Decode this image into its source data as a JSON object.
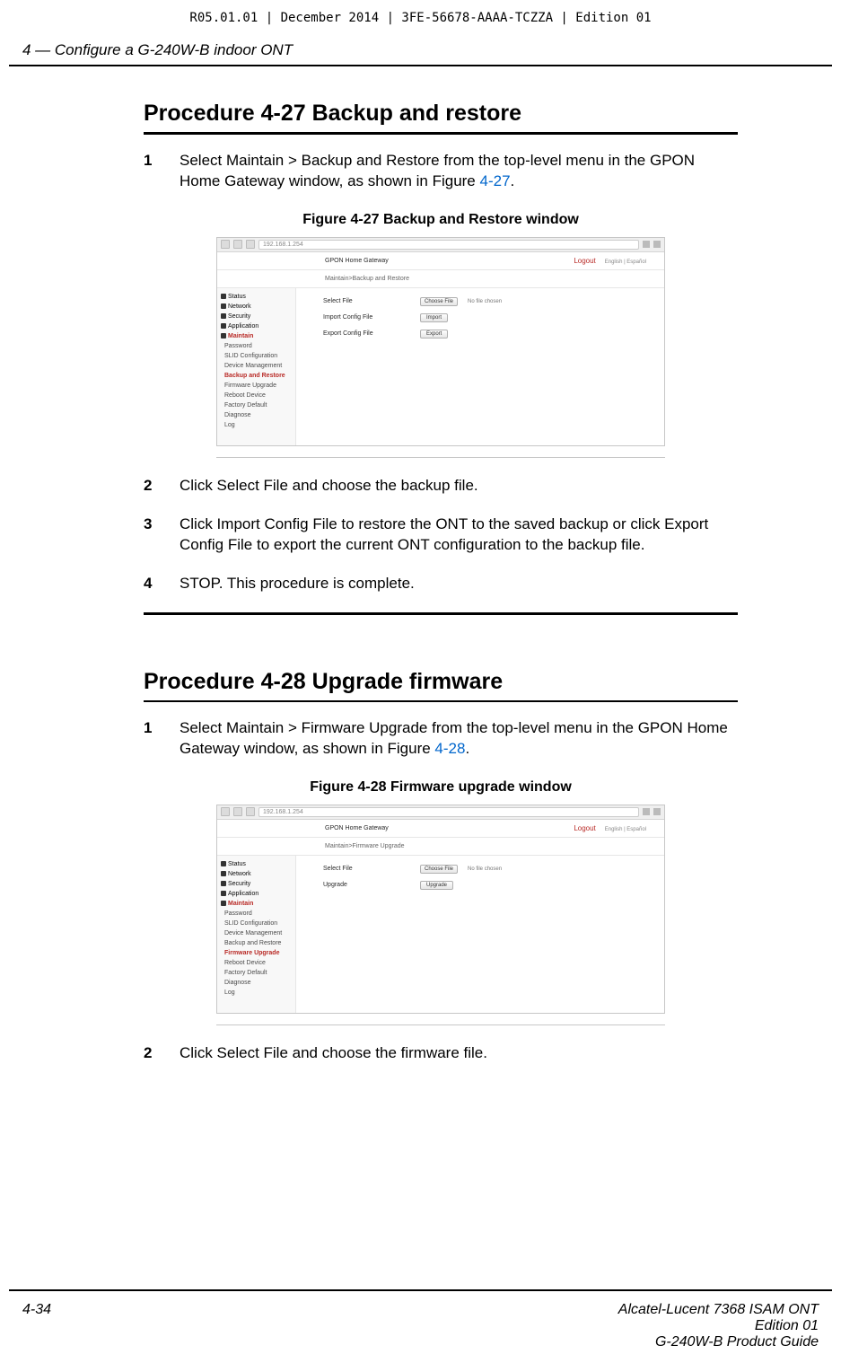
{
  "doc_header": "R05.01.01 | December 2014 | 3FE-56678-AAAA-TCZZA | Edition 01",
  "chapter_heading": "4 —  Configure a G-240W-B indoor ONT",
  "proc_427": {
    "title": "Procedure 4-27  Backup and restore",
    "steps": [
      {
        "n": "1",
        "pre": "Select Maintain > Backup and Restore from the top-level menu in the GPON Home Gateway window, as shown in Figure ",
        "ref": "4-27",
        "post": "."
      },
      {
        "n": "2",
        "text": "Click Select File and choose the backup file."
      },
      {
        "n": "3",
        "text": "Click Import Config File to restore the ONT to the saved backup or click Export Config File to export the current ONT configuration to the backup file."
      },
      {
        "n": "4",
        "text": "STOP. This procedure is complete."
      }
    ]
  },
  "fig_427": {
    "caption": "Figure 4-27  Backup and Restore window",
    "url": "192.168.1.254",
    "app_title": "GPON Home Gateway",
    "logout": "Logout",
    "lang": "English | Español",
    "breadcrumb": "Maintain>Backup and Restore",
    "side_main": [
      "Status",
      "Network",
      "Security",
      "Application"
    ],
    "side_active": "Maintain",
    "side_subs": [
      "Password",
      "SLID Configuration",
      "Device Management",
      "Backup and Restore",
      "Firmware Upgrade",
      "Reboot Device",
      "Factory Default",
      "Diagnose",
      "Log"
    ],
    "side_selected": "Backup and Restore",
    "rows": [
      {
        "label": "Select File",
        "btn": "Choose File",
        "trailing": "No file chosen"
      },
      {
        "label": "Import Config File",
        "btn": "Import"
      },
      {
        "label": "Export Config File",
        "btn": "Export"
      }
    ]
  },
  "proc_428": {
    "title": "Procedure 4-28  Upgrade firmware",
    "steps": [
      {
        "n": "1",
        "pre": "Select Maintain > Firmware Upgrade from the top-level menu in the GPON Home Gateway window, as shown in Figure ",
        "ref": "4-28",
        "post": "."
      },
      {
        "n": "2",
        "text": "Click Select File and choose the firmware file."
      }
    ]
  },
  "fig_428": {
    "caption": "Figure 4-28  Firmware upgrade window",
    "url": "192.168.1.254",
    "app_title": "GPON Home Gateway",
    "logout": "Logout",
    "lang": "English | Español",
    "breadcrumb": "Maintain>Firmware Upgrade",
    "side_main": [
      "Status",
      "Network",
      "Security",
      "Application"
    ],
    "side_active": "Maintain",
    "side_subs": [
      "Password",
      "SLID Configuration",
      "Device Management",
      "Backup and Restore",
      "Firmware Upgrade",
      "Reboot Device",
      "Factory Default",
      "Diagnose",
      "Log"
    ],
    "side_selected": "Firmware Upgrade",
    "rows": [
      {
        "label": "Select File",
        "btn": "Choose File",
        "trailing": "No file chosen"
      },
      {
        "label": "Upgrade",
        "btn": "Upgrade"
      }
    ]
  },
  "footer": {
    "page": "4-34",
    "line1": "Alcatel-Lucent 7368 ISAM ONT",
    "line2": "Edition 01",
    "line3": "G-240W-B Product Guide"
  }
}
